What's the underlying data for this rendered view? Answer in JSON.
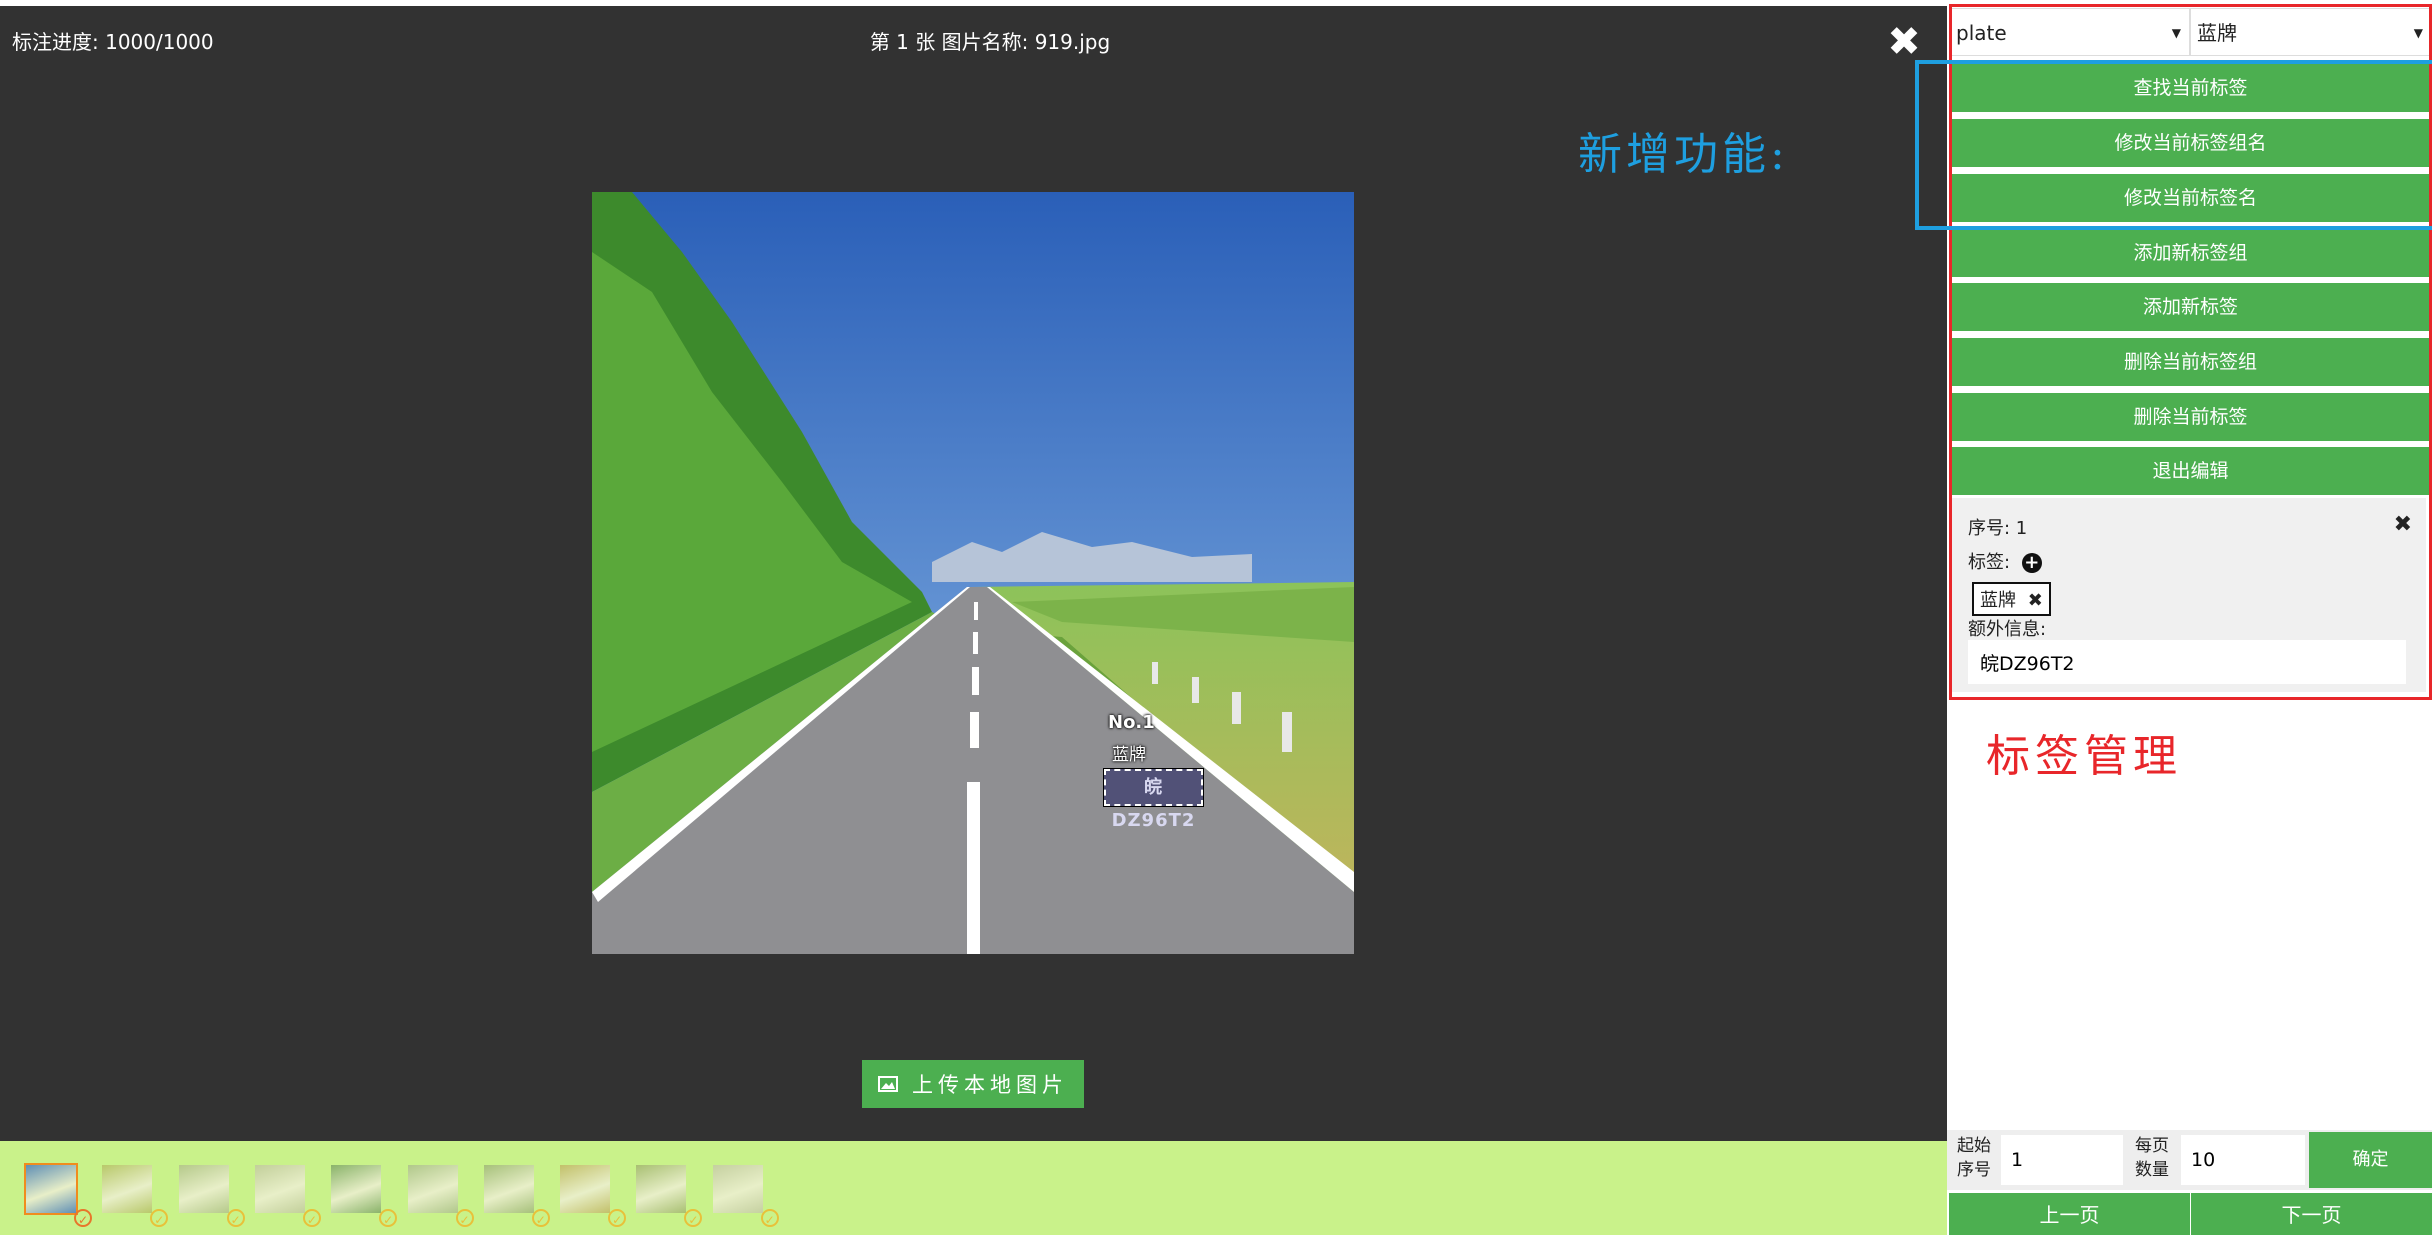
{
  "header": {
    "progress": "标注进度: 1000/1000",
    "image_name": "第 1 张 图片名称: 919.jpg",
    "close_icon": "close-icon"
  },
  "annotations": {
    "new_feature": "新增功能:",
    "tag_management": "标签管理"
  },
  "box": {
    "number": "No.1",
    "tag": "蓝牌",
    "plate_text": "皖DZ96T2"
  },
  "upload": {
    "label": "上传本地图片",
    "icon": "image-icon"
  },
  "thumbnails": [
    {
      "active": true
    },
    {
      "active": false
    },
    {
      "active": false
    },
    {
      "active": false
    },
    {
      "active": false
    },
    {
      "active": false
    },
    {
      "active": false
    },
    {
      "active": false
    },
    {
      "active": false
    },
    {
      "active": false
    }
  ],
  "panel": {
    "group_select": "plate",
    "tag_select": "蓝牌",
    "buttons": [
      "查找当前标签",
      "修改当前标签组名",
      "修改当前标签名",
      "添加新标签组",
      "添加新标签",
      "删除当前标签组",
      "删除当前标签",
      "退出编辑"
    ],
    "info": {
      "index_text": "序号: 1",
      "tags_label": "标签:",
      "tag_chip": "蓝牌",
      "extra_label": "额外信息:",
      "extra_value": "皖DZ96T2"
    },
    "pager": {
      "start_label_1": "起始",
      "start_label_2": "序号",
      "start_value": "1",
      "per_page_label_1": "每页",
      "per_page_label_2": "数量",
      "per_page_value": "10",
      "ok": "确定",
      "prev": "上一页",
      "next": "下一页"
    }
  },
  "colors": {
    "canvas": "#323232",
    "green": "#4caf50",
    "strip": "#c9f28a",
    "red_annotation": "#e8262a",
    "blue_annotation": "#1e9fe0"
  }
}
